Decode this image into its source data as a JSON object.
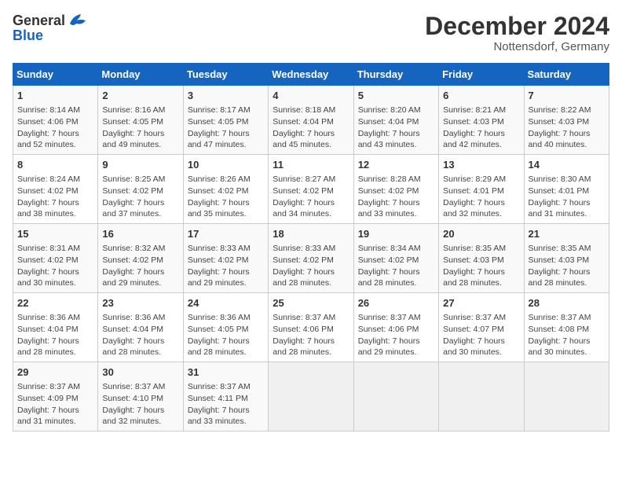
{
  "header": {
    "logo_general": "General",
    "logo_blue": "Blue",
    "month_title": "December 2024",
    "location": "Nottensdorf, Germany"
  },
  "calendar": {
    "headers": [
      "Sunday",
      "Monday",
      "Tuesday",
      "Wednesday",
      "Thursday",
      "Friday",
      "Saturday"
    ],
    "weeks": [
      [
        {
          "day": "",
          "empty": true
        },
        {
          "day": "",
          "empty": true
        },
        {
          "day": "",
          "empty": true
        },
        {
          "day": "",
          "empty": true
        },
        {
          "day": "",
          "empty": true
        },
        {
          "day": "",
          "empty": true
        },
        {
          "day": "",
          "empty": true
        }
      ],
      [
        {
          "day": "1",
          "sunrise": "Sunrise: 8:14 AM",
          "sunset": "Sunset: 4:06 PM",
          "daylight": "Daylight: 7 hours and 52 minutes."
        },
        {
          "day": "2",
          "sunrise": "Sunrise: 8:16 AM",
          "sunset": "Sunset: 4:05 PM",
          "daylight": "Daylight: 7 hours and 49 minutes."
        },
        {
          "day": "3",
          "sunrise": "Sunrise: 8:17 AM",
          "sunset": "Sunset: 4:05 PM",
          "daylight": "Daylight: 7 hours and 47 minutes."
        },
        {
          "day": "4",
          "sunrise": "Sunrise: 8:18 AM",
          "sunset": "Sunset: 4:04 PM",
          "daylight": "Daylight: 7 hours and 45 minutes."
        },
        {
          "day": "5",
          "sunrise": "Sunrise: 8:20 AM",
          "sunset": "Sunset: 4:04 PM",
          "daylight": "Daylight: 7 hours and 43 minutes."
        },
        {
          "day": "6",
          "sunrise": "Sunrise: 8:21 AM",
          "sunset": "Sunset: 4:03 PM",
          "daylight": "Daylight: 7 hours and 42 minutes."
        },
        {
          "day": "7",
          "sunrise": "Sunrise: 8:22 AM",
          "sunset": "Sunset: 4:03 PM",
          "daylight": "Daylight: 7 hours and 40 minutes."
        }
      ],
      [
        {
          "day": "8",
          "sunrise": "Sunrise: 8:24 AM",
          "sunset": "Sunset: 4:02 PM",
          "daylight": "Daylight: 7 hours and 38 minutes."
        },
        {
          "day": "9",
          "sunrise": "Sunrise: 8:25 AM",
          "sunset": "Sunset: 4:02 PM",
          "daylight": "Daylight: 7 hours and 37 minutes."
        },
        {
          "day": "10",
          "sunrise": "Sunrise: 8:26 AM",
          "sunset": "Sunset: 4:02 PM",
          "daylight": "Daylight: 7 hours and 35 minutes."
        },
        {
          "day": "11",
          "sunrise": "Sunrise: 8:27 AM",
          "sunset": "Sunset: 4:02 PM",
          "daylight": "Daylight: 7 hours and 34 minutes."
        },
        {
          "day": "12",
          "sunrise": "Sunrise: 8:28 AM",
          "sunset": "Sunset: 4:02 PM",
          "daylight": "Daylight: 7 hours and 33 minutes."
        },
        {
          "day": "13",
          "sunrise": "Sunrise: 8:29 AM",
          "sunset": "Sunset: 4:01 PM",
          "daylight": "Daylight: 7 hours and 32 minutes."
        },
        {
          "day": "14",
          "sunrise": "Sunrise: 8:30 AM",
          "sunset": "Sunset: 4:01 PM",
          "daylight": "Daylight: 7 hours and 31 minutes."
        }
      ],
      [
        {
          "day": "15",
          "sunrise": "Sunrise: 8:31 AM",
          "sunset": "Sunset: 4:02 PM",
          "daylight": "Daylight: 7 hours and 30 minutes."
        },
        {
          "day": "16",
          "sunrise": "Sunrise: 8:32 AM",
          "sunset": "Sunset: 4:02 PM",
          "daylight": "Daylight: 7 hours and 29 minutes."
        },
        {
          "day": "17",
          "sunrise": "Sunrise: 8:33 AM",
          "sunset": "Sunset: 4:02 PM",
          "daylight": "Daylight: 7 hours and 29 minutes."
        },
        {
          "day": "18",
          "sunrise": "Sunrise: 8:33 AM",
          "sunset": "Sunset: 4:02 PM",
          "daylight": "Daylight: 7 hours and 28 minutes."
        },
        {
          "day": "19",
          "sunrise": "Sunrise: 8:34 AM",
          "sunset": "Sunset: 4:02 PM",
          "daylight": "Daylight: 7 hours and 28 minutes."
        },
        {
          "day": "20",
          "sunrise": "Sunrise: 8:35 AM",
          "sunset": "Sunset: 4:03 PM",
          "daylight": "Daylight: 7 hours and 28 minutes."
        },
        {
          "day": "21",
          "sunrise": "Sunrise: 8:35 AM",
          "sunset": "Sunset: 4:03 PM",
          "daylight": "Daylight: 7 hours and 28 minutes."
        }
      ],
      [
        {
          "day": "22",
          "sunrise": "Sunrise: 8:36 AM",
          "sunset": "Sunset: 4:04 PM",
          "daylight": "Daylight: 7 hours and 28 minutes."
        },
        {
          "day": "23",
          "sunrise": "Sunrise: 8:36 AM",
          "sunset": "Sunset: 4:04 PM",
          "daylight": "Daylight: 7 hours and 28 minutes."
        },
        {
          "day": "24",
          "sunrise": "Sunrise: 8:36 AM",
          "sunset": "Sunset: 4:05 PM",
          "daylight": "Daylight: 7 hours and 28 minutes."
        },
        {
          "day": "25",
          "sunrise": "Sunrise: 8:37 AM",
          "sunset": "Sunset: 4:06 PM",
          "daylight": "Daylight: 7 hours and 28 minutes."
        },
        {
          "day": "26",
          "sunrise": "Sunrise: 8:37 AM",
          "sunset": "Sunset: 4:06 PM",
          "daylight": "Daylight: 7 hours and 29 minutes."
        },
        {
          "day": "27",
          "sunrise": "Sunrise: 8:37 AM",
          "sunset": "Sunset: 4:07 PM",
          "daylight": "Daylight: 7 hours and 30 minutes."
        },
        {
          "day": "28",
          "sunrise": "Sunrise: 8:37 AM",
          "sunset": "Sunset: 4:08 PM",
          "daylight": "Daylight: 7 hours and 30 minutes."
        }
      ],
      [
        {
          "day": "29",
          "sunrise": "Sunrise: 8:37 AM",
          "sunset": "Sunset: 4:09 PM",
          "daylight": "Daylight: 7 hours and 31 minutes."
        },
        {
          "day": "30",
          "sunrise": "Sunrise: 8:37 AM",
          "sunset": "Sunset: 4:10 PM",
          "daylight": "Daylight: 7 hours and 32 minutes."
        },
        {
          "day": "31",
          "sunrise": "Sunrise: 8:37 AM",
          "sunset": "Sunset: 4:11 PM",
          "daylight": "Daylight: 7 hours and 33 minutes."
        },
        {
          "day": "",
          "empty": true
        },
        {
          "day": "",
          "empty": true
        },
        {
          "day": "",
          "empty": true
        },
        {
          "day": "",
          "empty": true
        }
      ]
    ]
  }
}
